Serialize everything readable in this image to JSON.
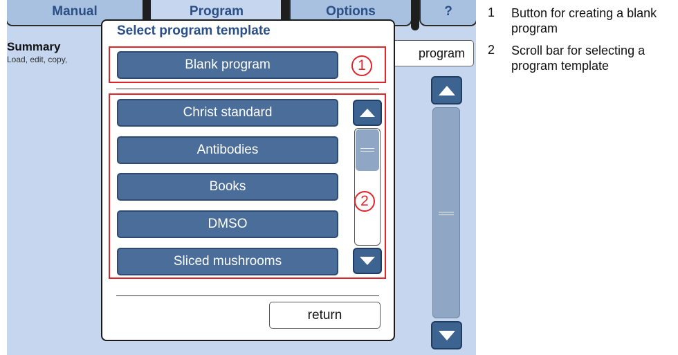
{
  "tabs": [
    {
      "label": "Manual",
      "active": false
    },
    {
      "label": "Program",
      "active": true
    },
    {
      "label": "Options",
      "active": false
    },
    {
      "label": "?",
      "active": false
    }
  ],
  "summary": {
    "title": "Summary",
    "subtitle": "Load, edit, copy,"
  },
  "background_button": {
    "label": "program"
  },
  "dialog": {
    "title": "Select program template",
    "blank_button": "Blank program",
    "templates": [
      "Christ standard",
      "Antibodies",
      "Books",
      "DMSO",
      "Sliced mushrooms"
    ],
    "return_button": "return",
    "callouts": [
      "1",
      "2"
    ]
  },
  "legend": [
    {
      "num": "1",
      "text": "Button for creating a blank program"
    },
    {
      "num": "2",
      "text": "Scroll bar for selecting a program template"
    }
  ],
  "colors": {
    "screen_bg": "#c5d6ee",
    "button_bg": "#4a6d99",
    "title_color": "#2a4f86",
    "callout_red": "#e0242a"
  },
  "icons": {
    "scroll_up": "triangle-up-icon",
    "scroll_down": "triangle-down-icon"
  }
}
